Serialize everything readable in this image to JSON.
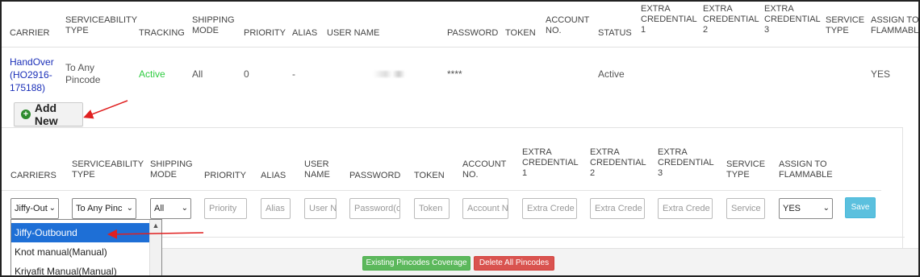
{
  "existing_table": {
    "headers": [
      "CARRIER",
      "SERVICEABILITY TYPE",
      "TRACKING",
      "SHIPPING MODE",
      "PRIORITY",
      "ALIAS",
      "USER NAME",
      "PASSWORD",
      "TOKEN",
      "ACCOUNT NO.",
      "STATUS",
      "EXTRA CREDENTIAL 1",
      "EXTRA CREDENTIAL 2",
      "EXTRA CREDENTIAL 3",
      "SERVICE TYPE",
      "ASSIGN TO FLAMMABLE"
    ],
    "row": {
      "carrier": "HandOver (HO2916-175188)",
      "serviceability": "To Any Pincode",
      "tracking": "Active",
      "shipping_mode": "All",
      "priority": "0",
      "alias": "-",
      "password": "****",
      "status": "Active",
      "flammable": "YES"
    }
  },
  "add_new_label": "Add New",
  "new_form": {
    "headers": [
      "CARRIERS",
      "SERVICEABILITY TYPE",
      "SHIPPING MODE",
      "PRIORITY",
      "ALIAS",
      "USER NAME",
      "PASSWORD",
      "TOKEN",
      "ACCOUNT NO.",
      "EXTRA CREDENTIAL 1",
      "EXTRA CREDENTIAL 2",
      "EXTRA CREDENTIAL 3",
      "SERVICE TYPE",
      "ASSIGN TO FLAMMABLE"
    ],
    "carrier_value": "Jiffy-Out",
    "serviceability_value": "To Any Pinc",
    "shipping_mode_value": "All",
    "placeholders": {
      "priority": "Priority",
      "alias": "Alias",
      "user_name": "User N",
      "password": "Password(o",
      "token": "Token",
      "account_no": "Account N",
      "extra1": "Extra Crede",
      "extra2": "Extra Crede",
      "extra3": "Extra Crede",
      "service_type": "Service"
    },
    "flammable_value": "YES",
    "save_label": "Save"
  },
  "carrier_dropdown": {
    "options": [
      "Jiffy-Outbound",
      "Knot manual(Manual)",
      "Kriyafit Manual(Manual)"
    ],
    "selected_index": 0
  },
  "footer": {
    "coverage_label": "Existing Pincodes Coverage",
    "delete_label": "Delete All Pincodes"
  },
  "colors": {
    "link": "#1a2fb8",
    "active": "#2ecc40",
    "save": "#5bc0de",
    "coverage": "#5cb85c",
    "delete": "#d9534f",
    "dropdown_selected": "#1e6fd6",
    "annotation_arrow": "#e02020"
  }
}
